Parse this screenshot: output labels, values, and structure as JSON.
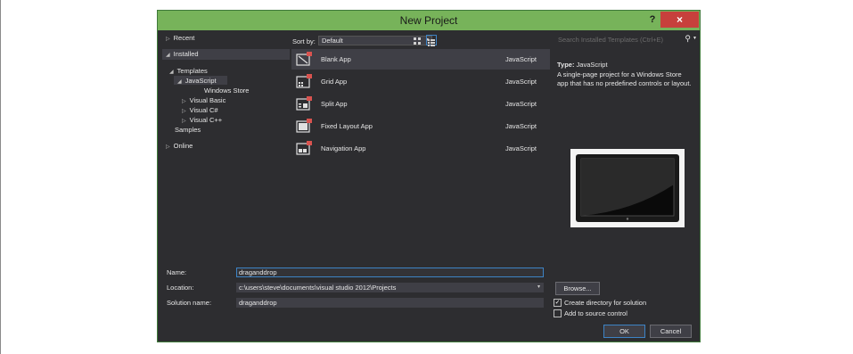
{
  "dialog": {
    "title": "New Project",
    "help_label": "?",
    "close_label": "×"
  },
  "nav": {
    "recent": "Recent",
    "installed": "Installed",
    "templates": "Templates",
    "javascript": "JavaScript",
    "windows_store": "Windows Store",
    "visual_basic": "Visual Basic",
    "visual_csharp": "Visual C#",
    "visual_cpp": "Visual C++",
    "samples": "Samples",
    "online": "Online"
  },
  "toolbar": {
    "sortby_label": "Sort by:",
    "sortby_value": "Default"
  },
  "search": {
    "placeholder": "Search Installed Templates (Ctrl+E)"
  },
  "templates": [
    {
      "name": "Blank App",
      "language": "JavaScript"
    },
    {
      "name": "Grid App",
      "language": "JavaScript"
    },
    {
      "name": "Split App",
      "language": "JavaScript"
    },
    {
      "name": "Fixed Layout App",
      "language": "JavaScript"
    },
    {
      "name": "Navigation App",
      "language": "JavaScript"
    }
  ],
  "details": {
    "type_label": "Type:",
    "type_value": "JavaScript",
    "description": "A single-page project for a Windows Store app that has no predefined controls or layout."
  },
  "form": {
    "name_label": "Name:",
    "name_value": "draganddrop",
    "location_label": "Location:",
    "location_value": "c:\\users\\steve\\documents\\visual studio 2012\\Projects",
    "solution_label": "Solution name:",
    "solution_value": "draganddrop",
    "browse_label": "Browse...",
    "create_dir_label": "Create directory for solution",
    "create_dir_checked": true,
    "source_control_label": "Add to source control",
    "source_control_checked": false,
    "ok_label": "OK",
    "cancel_label": "Cancel"
  },
  "colors": {
    "titlebar": "#77b35a",
    "background": "#2d2d30",
    "selection": "#3f3f46",
    "accent": "#3d83c5",
    "close": "#c7403c"
  }
}
